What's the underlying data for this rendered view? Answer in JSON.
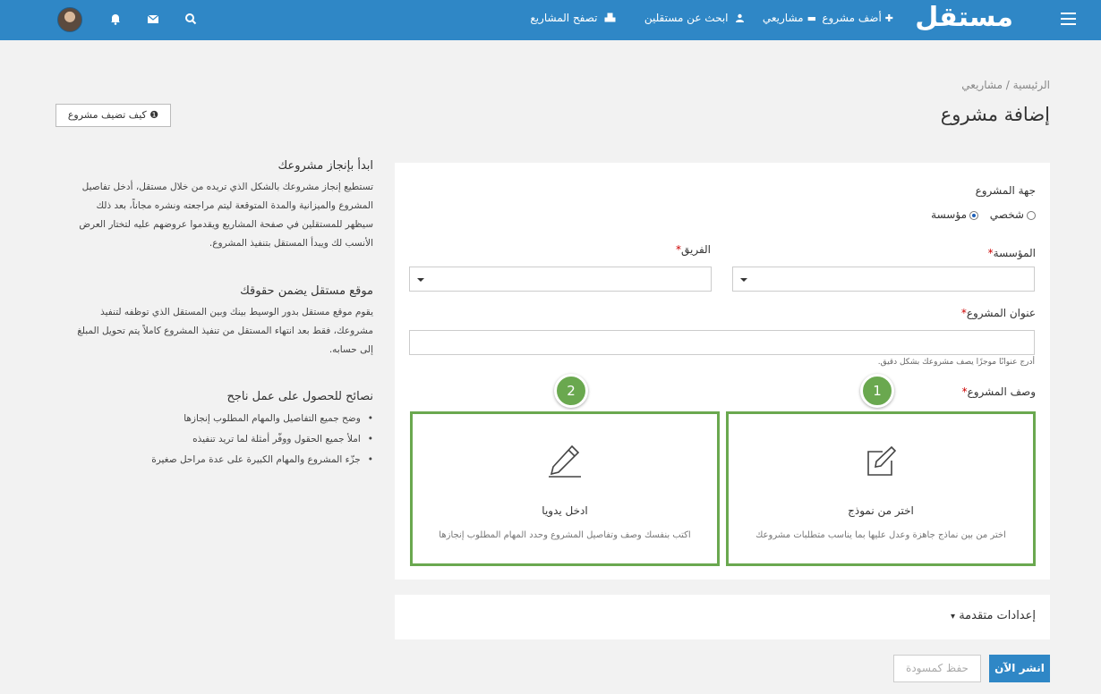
{
  "topbar": {
    "logo": "مستقل",
    "nav": {
      "add_project": "أضف مشروع",
      "my_projects": "مشاريعي",
      "find_freelancers": "ابحث عن مستقلين",
      "browse_projects": "تصفح المشاريع"
    },
    "icons": [
      "menu-icon",
      "plus-icon",
      "folder-icon",
      "users-icon",
      "cubes-icon",
      "search-icon",
      "envelope-icon",
      "bell-icon",
      "avatar"
    ],
    "color": "#2f87c6"
  },
  "breadcrumb": "الرئيسية / مشاريعي",
  "page_title": "إضافة مشروع",
  "how_to_button": "كيف تضيف مشروع",
  "form": {
    "project_party_label": "جهة المشروع",
    "options": {
      "institution": "مؤسسة",
      "personal": "شخصي",
      "selected": "مؤسسة"
    },
    "institution_label": "المؤسسة",
    "team_label": "الفريق",
    "required_mark": "*",
    "title_label": "عنوان المشروع",
    "title_value": "",
    "title_hint": "أدرج عنوانًا موجزًا يصف مشروعك بشكل دقيق.",
    "description_label": "وصف المشروع",
    "template_option": {
      "badge": "1",
      "title": "اختر من نموذج",
      "description": "اختر من بين نماذج جاهزة وعدل عليها بما يناسب متطلبات مشروعك"
    },
    "manual_option": {
      "badge": "2",
      "title": "ادخل يدويا",
      "description": "اكتب بنفسك وصف وتفاصيل المشروع وحدد المهام المطلوب إنجازها"
    },
    "option_border_color": "#6aa84f"
  },
  "advanced_settings": "إعدادات متقدمة",
  "buttons": {
    "publish": "انشر الآن",
    "save_draft": "حفظ كمسودة"
  },
  "side": {
    "sections": [
      {
        "title": "ابدأ بإنجاز مشروعك",
        "lines": [
          "تستطيع إنجاز مشروعك بالشكل الذي تريده من خلال مستقل، أدخل تفاصيل",
          "المشروع والميزانية والمدة المتوقعة ليتم مراجعته ونشره مجاناً، بعد ذلك",
          "سيظهر للمستقلين في صفحة المشاريع ويقدموا عروضهم عليه لتختار العرض",
          "الأنسب لك ويبدأ المستقل بتنفيذ المشروع."
        ]
      },
      {
        "title": "موقع مستقل يضمن حقوقك",
        "lines": [
          "يقوم موقع مستقل بدور الوسيط بينك وبين المستقل الذي توظفه لتنفيذ",
          "مشروعك، فقط بعد انتهاء المستقل من تنفيذ المشروع كاملاً يتم تحويل المبلغ",
          "إلى حسابه."
        ]
      }
    ],
    "tips_title": "نصائح للحصول على عمل ناجح",
    "tips": [
      "وضح جميع التفاصيل والمهام المطلوب إنجازها",
      "املأ جميع الحقول ووفّر أمثلة لما تريد تنفيذه",
      "جزّء المشروع والمهام الكبيرة على عدة مراحل صغيرة"
    ]
  }
}
